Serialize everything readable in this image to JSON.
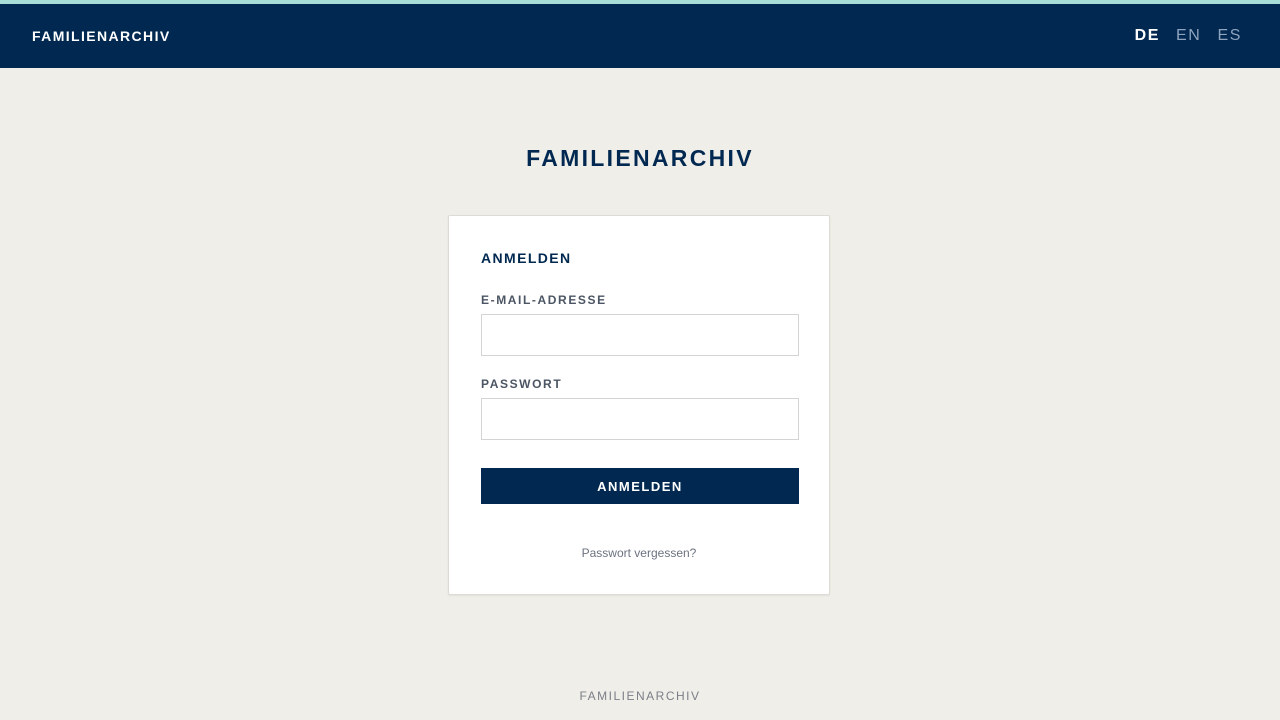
{
  "header": {
    "brand": "FAMILIENARCHIV",
    "languages": [
      {
        "code": "DE",
        "active": true
      },
      {
        "code": "EN",
        "active": false
      },
      {
        "code": "ES",
        "active": false
      }
    ]
  },
  "main": {
    "title": "FAMILIENARCHIV"
  },
  "login": {
    "heading": "ANMELDEN",
    "email_label": "E-MAIL-ADRESSE",
    "email_value": "",
    "password_label": "PASSWORT",
    "password_value": "",
    "submit_label": "ANMELDEN",
    "forgot_link": "Passwort vergessen?"
  },
  "footer": {
    "text": "FAMILIENARCHIV"
  },
  "colors": {
    "primary": "#002850",
    "accent": "#a8dcd6",
    "background": "#f0eee9"
  }
}
